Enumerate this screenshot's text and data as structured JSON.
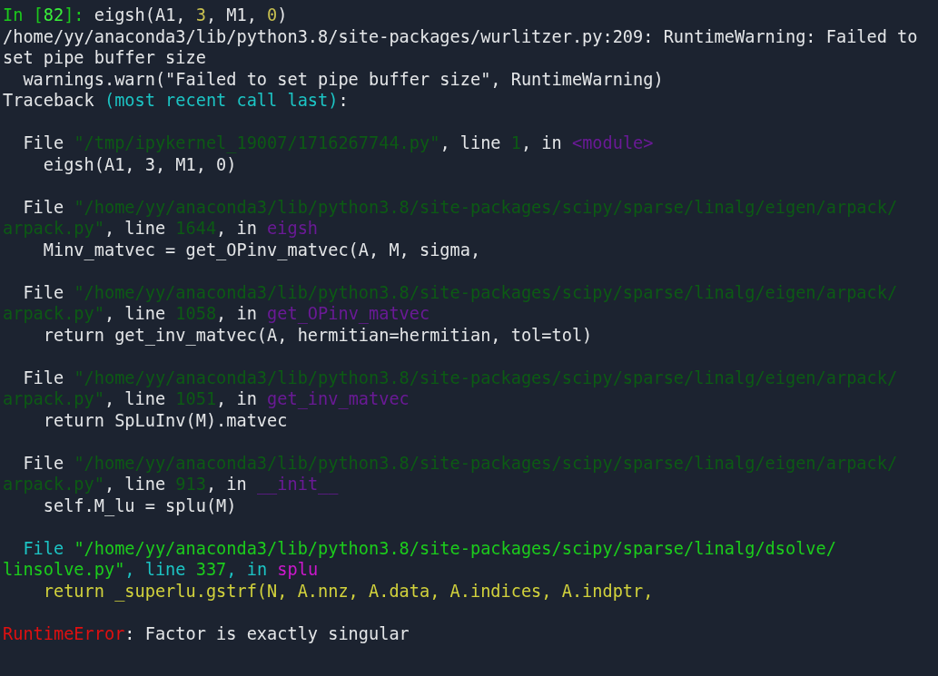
{
  "blocks": [
    {
      "lines": [
        [
          {
            "text": "In [",
            "kind": "prompt"
          },
          {
            "text": "82",
            "kind": "prompt_num"
          },
          {
            "text": "]: ",
            "kind": "prompt"
          },
          {
            "text": "eigsh(A1, ",
            "kind": "plain"
          },
          {
            "text": "3",
            "kind": "number"
          },
          {
            "text": ", M1, ",
            "kind": "plain"
          },
          {
            "text": "0",
            "kind": "number"
          },
          {
            "text": ")",
            "kind": "plain"
          }
        ],
        [
          {
            "text": "/home/yy/anaconda3/lib/python3.8/site-packages/wurlitzer.py:209: RuntimeWarning: Failed to",
            "kind": "plain"
          }
        ],
        [
          {
            "text": "set pipe buffer size",
            "kind": "plain"
          }
        ],
        [
          {
            "text": "  warnings.warn(\"Failed to set pipe buffer size\", RuntimeWarning)",
            "kind": "plain"
          }
        ],
        [
          {
            "text": "Traceback ",
            "kind": "plain"
          },
          {
            "text": "(most recent call last)",
            "kind": "cyan"
          },
          {
            "text": ":",
            "kind": "plain"
          }
        ]
      ]
    },
    {
      "lines": [
        [
          {
            "text": "  File ",
            "kind": "plain"
          },
          {
            "text": "\"/tmp/ipykernel_19007/1716267744.py\"",
            "kind": "dim_path"
          },
          {
            "text": ", line ",
            "kind": "plain"
          },
          {
            "text": "1",
            "kind": "dim_path"
          },
          {
            "text": ", in ",
            "kind": "plain"
          },
          {
            "text": "<module>",
            "kind": "dim_func"
          }
        ],
        [
          {
            "text": "    eigsh(A1, 3, M1, 0)",
            "kind": "plain"
          }
        ]
      ]
    },
    {
      "lines": [
        [
          {
            "text": "  File ",
            "kind": "plain"
          },
          {
            "text": "\"/home/yy/anaconda3/lib/python3.8/site-packages/scipy/sparse/linalg/eigen/arpack/",
            "kind": "dim_path"
          }
        ],
        [
          {
            "text": "arpack.py\"",
            "kind": "dim_path"
          },
          {
            "text": ", line ",
            "kind": "plain"
          },
          {
            "text": "1644",
            "kind": "dim_path"
          },
          {
            "text": ", in ",
            "kind": "plain"
          },
          {
            "text": "eigsh",
            "kind": "dim_func"
          }
        ],
        [
          {
            "text": "    Minv_matvec = get_OPinv_matvec(A, M, sigma,",
            "kind": "plain"
          }
        ]
      ]
    },
    {
      "lines": [
        [
          {
            "text": "  File ",
            "kind": "plain"
          },
          {
            "text": "\"/home/yy/anaconda3/lib/python3.8/site-packages/scipy/sparse/linalg/eigen/arpack/",
            "kind": "dim_path"
          }
        ],
        [
          {
            "text": "arpack.py\"",
            "kind": "dim_path"
          },
          {
            "text": ", line ",
            "kind": "plain"
          },
          {
            "text": "1058",
            "kind": "dim_path"
          },
          {
            "text": ", in ",
            "kind": "plain"
          },
          {
            "text": "get_OPinv_matvec",
            "kind": "dim_func"
          }
        ],
        [
          {
            "text": "    return get_inv_matvec(A, hermitian=hermitian, tol=tol)",
            "kind": "plain"
          }
        ]
      ]
    },
    {
      "lines": [
        [
          {
            "text": "  File ",
            "kind": "plain"
          },
          {
            "text": "\"/home/yy/anaconda3/lib/python3.8/site-packages/scipy/sparse/linalg/eigen/arpack/",
            "kind": "dim_path"
          }
        ],
        [
          {
            "text": "arpack.py\"",
            "kind": "dim_path"
          },
          {
            "text": ", line ",
            "kind": "plain"
          },
          {
            "text": "1051",
            "kind": "dim_path"
          },
          {
            "text": ", in ",
            "kind": "plain"
          },
          {
            "text": "get_inv_matvec",
            "kind": "dim_func"
          }
        ],
        [
          {
            "text": "    return SpLuInv(M).matvec",
            "kind": "plain"
          }
        ]
      ]
    },
    {
      "lines": [
        [
          {
            "text": "  File ",
            "kind": "plain"
          },
          {
            "text": "\"/home/yy/anaconda3/lib/python3.8/site-packages/scipy/sparse/linalg/eigen/arpack/",
            "kind": "dim_path"
          }
        ],
        [
          {
            "text": "arpack.py\"",
            "kind": "dim_path"
          },
          {
            "text": ", line ",
            "kind": "plain"
          },
          {
            "text": "913",
            "kind": "dim_path"
          },
          {
            "text": ", in ",
            "kind": "plain"
          },
          {
            "text": "__init__",
            "kind": "dim_func"
          }
        ],
        [
          {
            "text": "    self.M_lu = splu(M)",
            "kind": "plain"
          }
        ]
      ]
    },
    {
      "lines": [
        [
          {
            "text": "  File ",
            "kind": "cyan"
          },
          {
            "text": "\"/home/yy/anaconda3/lib/python3.8/site-packages/scipy/sparse/linalg/dsolve/",
            "kind": "path"
          }
        ],
        [
          {
            "text": "linsolve.py\"",
            "kind": "path"
          },
          {
            "text": ", line ",
            "kind": "cyan"
          },
          {
            "text": "337",
            "kind": "path"
          },
          {
            "text": ", in ",
            "kind": "cyan"
          },
          {
            "text": "splu",
            "kind": "func"
          }
        ],
        [
          {
            "text": "    return _superlu.gstrf(N, A.nnz, A.data, A.indices, A.indptr,",
            "kind": "code_hl"
          }
        ]
      ]
    },
    {
      "lines": [
        [
          {
            "text": "RuntimeError",
            "kind": "error"
          },
          {
            "text": ": Factor is exactly singular",
            "kind": "plain"
          }
        ]
      ]
    }
  ]
}
